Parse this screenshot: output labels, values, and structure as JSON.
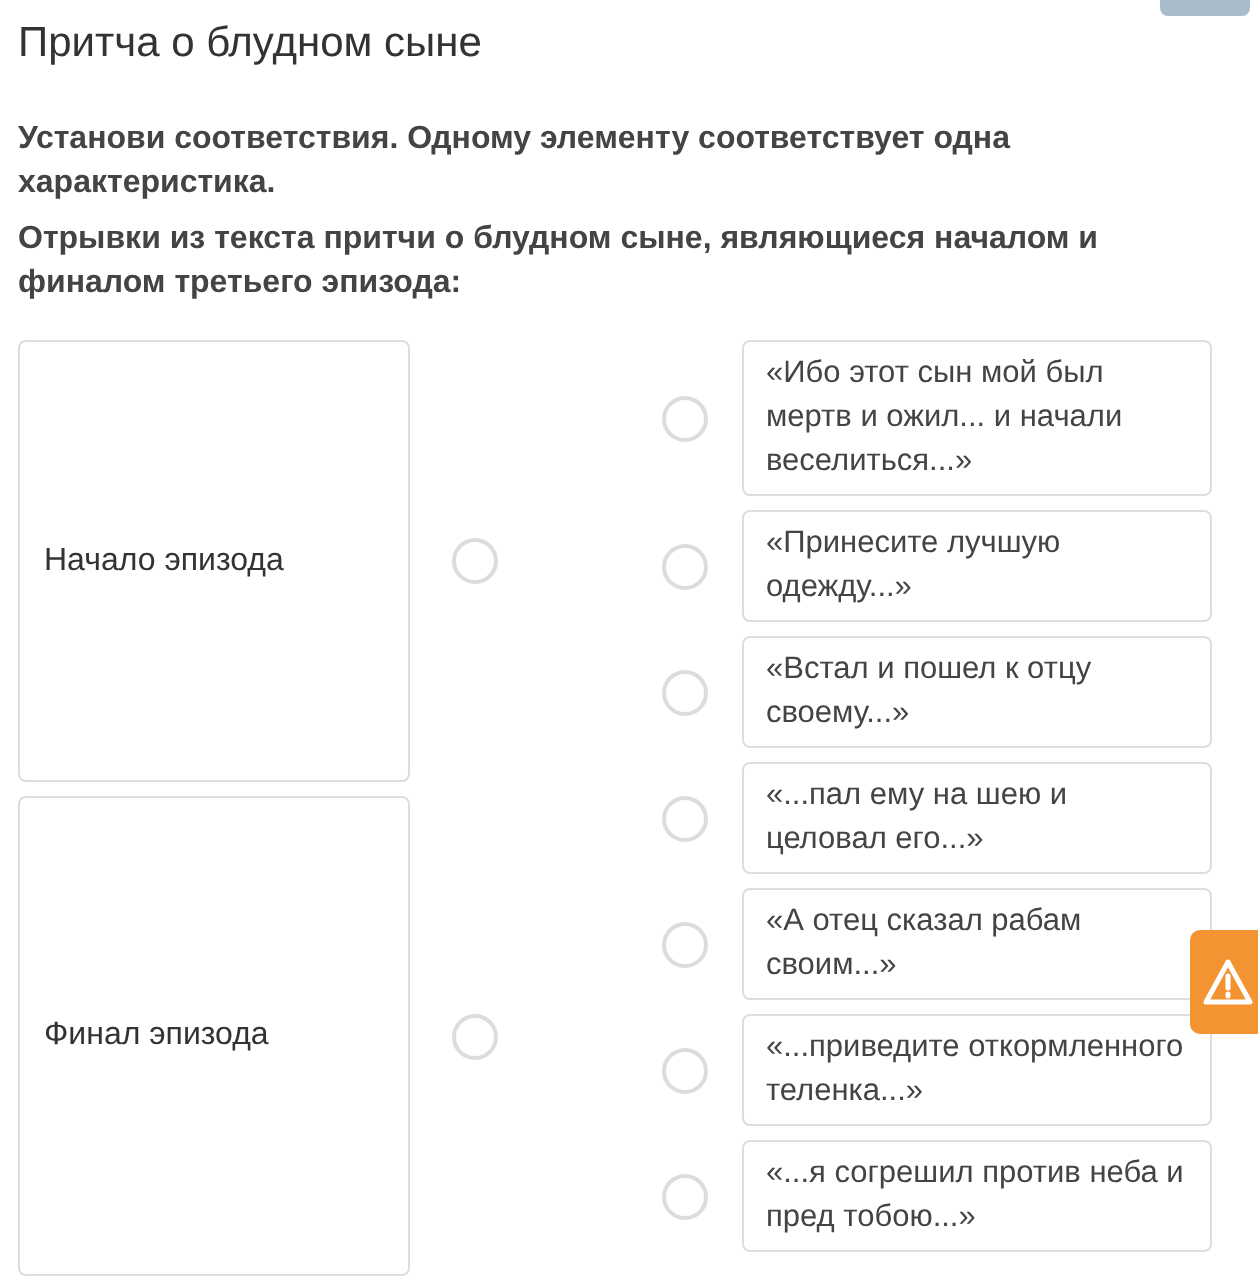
{
  "title": "Притча о блудном сыне",
  "instructions": [
    "Установи соответствия. Одному элементу соответствует одна характеристика.",
    "Отрывки из текста притчи о блудном сыне, являющиеся началом и финалом третьего эпизода:"
  ],
  "left_items": [
    {
      "text": "Начало эпизода",
      "selected": false
    },
    {
      "text": "Финал эпизода",
      "selected": false
    }
  ],
  "right_items": [
    {
      "text": "«Ибо этот сын мой был мертв и ожил... и начали веселиться...»",
      "selected": false
    },
    {
      "text": "«Принесите лучшую одежду...»",
      "selected": false
    },
    {
      "text": "«Встал и пошел к отцу своему...»",
      "selected": false
    },
    {
      "text": "«...пал ему на шею и целовал его...»",
      "selected": false
    },
    {
      "text": "«А отец сказал рабам своим...»",
      "selected": false
    },
    {
      "text": "«...приведите откормленного теленка...»",
      "selected": false
    },
    {
      "text": "«...я согрешил против неба и пред тобою...»",
      "selected": false
    }
  ]
}
